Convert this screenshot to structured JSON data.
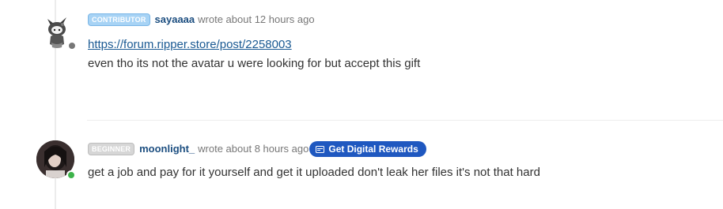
{
  "posts": [
    {
      "badge": "CONTRIBUTOR",
      "username": "sayaaaa",
      "meta": "wrote about 12 hours ago",
      "link": "https://forum.ripper.store/post/2258003",
      "text": "even tho its not the avatar u were looking for but accept this gift",
      "status_color": "#777777",
      "avatar": "cartoon-avatar"
    },
    {
      "badge": "BEGINNER",
      "username": "moonlight_",
      "meta": "wrote about 8 hours ago",
      "action_button": {
        "label": "Get Digital Rewards",
        "icon": "card-icon",
        "color": "#1f58c0"
      },
      "text": "get a job and pay for it yourself and get it uploaded don't leak her files it's not that hard",
      "status_color": "#3db34a",
      "avatar": "photo-avatar"
    }
  ]
}
